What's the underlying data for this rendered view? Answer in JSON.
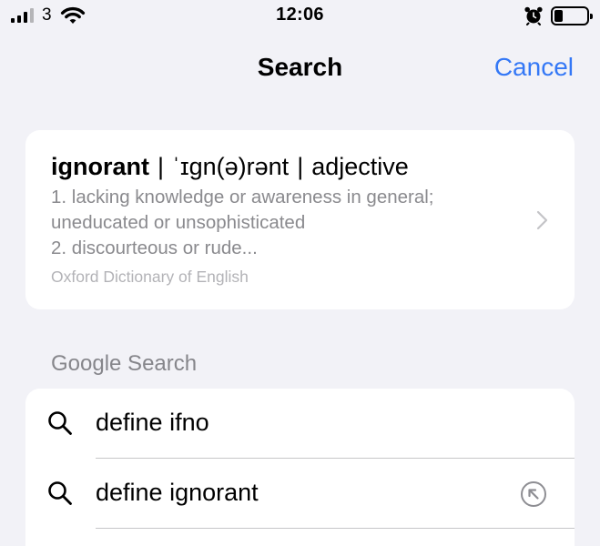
{
  "status_bar": {
    "carrier": "3",
    "time": "12:06",
    "signal_bars_active": 3,
    "signal_bars_total": 4,
    "battery_level_fraction": 0.2,
    "icons": [
      "signal-icon",
      "wifi-icon",
      "alarm-icon",
      "battery-icon"
    ]
  },
  "nav": {
    "title": "Search",
    "cancel_label": "Cancel"
  },
  "dictionary": {
    "word": "ignorant",
    "separator": "|",
    "pronunciation": "ˈɪɡn(ə)rənt",
    "part_of_speech": "adjective",
    "definition_line_1": "1. lacking knowledge or awareness in general;",
    "definition_line_2": "uneducated or unsophisticated",
    "definition_line_3": "2. discourteous or rude...",
    "source": "Oxford Dictionary of English"
  },
  "google_search": {
    "section_title": "Google Search",
    "suggestions": [
      {
        "label": "define ifno",
        "icon": "search-icon"
      },
      {
        "label": "define ignorant",
        "icon": "search-icon",
        "action_icon": "fill-arrow-icon"
      }
    ]
  },
  "colors": {
    "background": "#f2f2f7",
    "accent": "#3478f6",
    "secondary_text": "#8a8a8e",
    "tertiary_text": "#b3b3b7"
  }
}
